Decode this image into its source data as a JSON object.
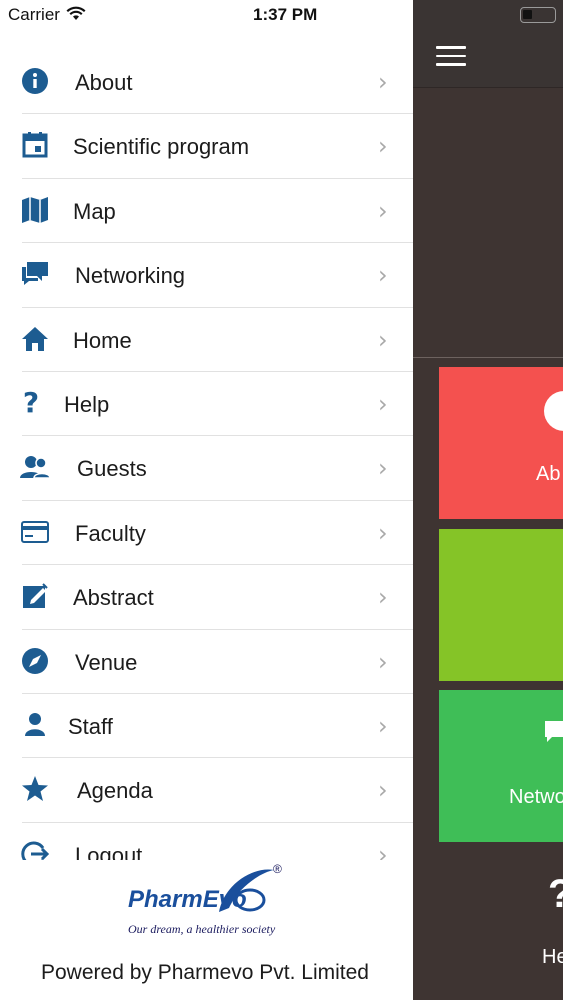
{
  "status_bar": {
    "carrier": "Carrier",
    "time": "1:37 PM"
  },
  "menu": {
    "items": [
      {
        "label": "About",
        "icon": "info-icon"
      },
      {
        "label": "Scientific program",
        "icon": "calendar-icon"
      },
      {
        "label": "Map",
        "icon": "map-icon"
      },
      {
        "label": "Networking",
        "icon": "chat-icon"
      },
      {
        "label": "Home",
        "icon": "home-icon"
      },
      {
        "label": "Help",
        "icon": "question-icon"
      },
      {
        "label": "Guests",
        "icon": "people-icon"
      },
      {
        "label": "Faculty",
        "icon": "card-icon"
      },
      {
        "label": "Abstract",
        "icon": "edit-icon"
      },
      {
        "label": "Venue",
        "icon": "compass-icon"
      },
      {
        "label": "Staff",
        "icon": "person-icon"
      },
      {
        "label": "Agenda",
        "icon": "star-icon"
      },
      {
        "label": "Logout",
        "icon": "logout-icon"
      }
    ]
  },
  "logo": {
    "name": "PharmEvo",
    "tagline": "Our dream, a healthier society"
  },
  "footer": {
    "powered_by": "Powered by Pharmevo Pvt. Limited"
  },
  "background": {
    "tiles": [
      {
        "label": "Ab",
        "color": "#f4514f"
      },
      {
        "label": "",
        "color": "#85c427"
      },
      {
        "label": "Netwo",
        "color": "#3fbe57"
      }
    ],
    "help_label": "He"
  },
  "colors": {
    "icon": "#1d5c91",
    "chevron": "#a9a9a9",
    "divider": "#e1e1e1"
  }
}
